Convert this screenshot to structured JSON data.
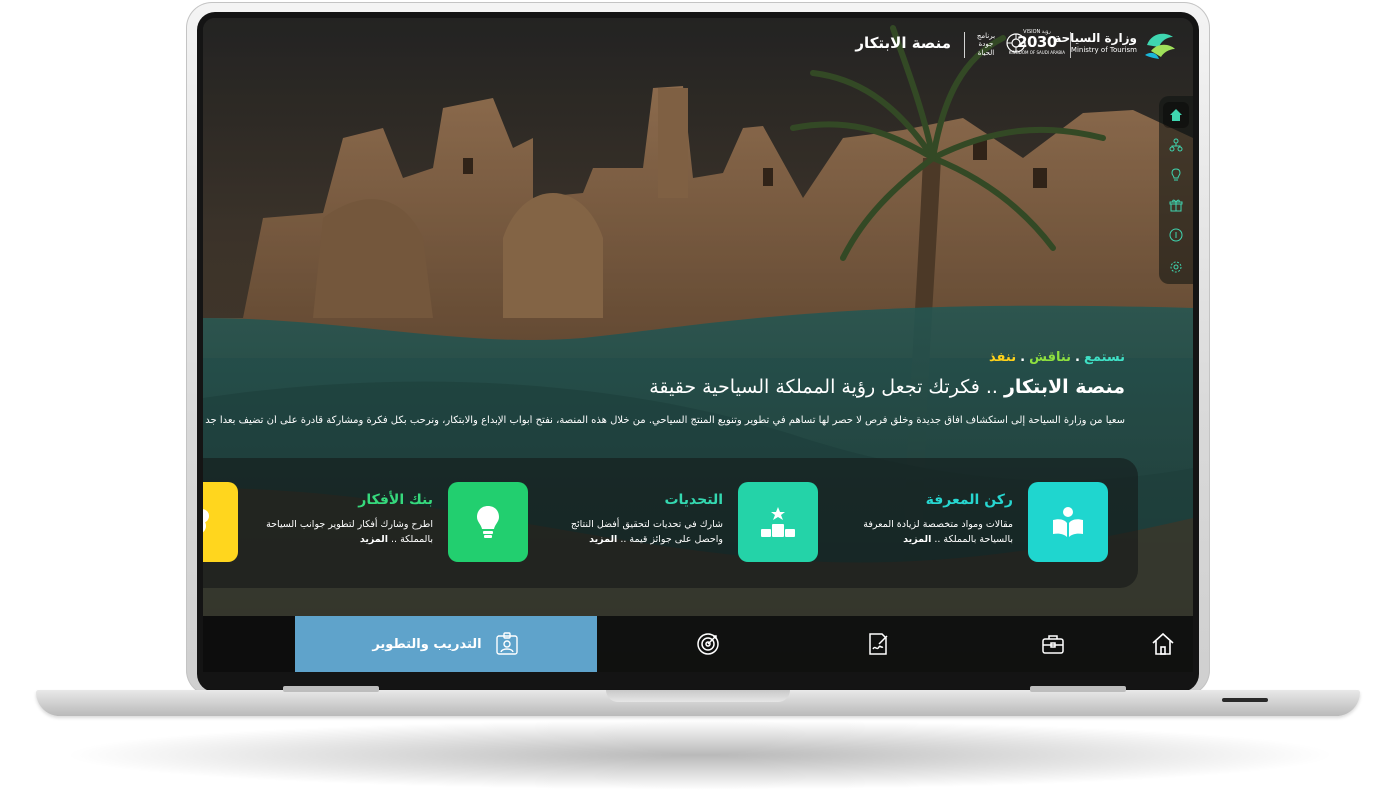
{
  "header": {
    "platform_title": "منصة الابتكار",
    "ministry_ar": "وزارة السياحة",
    "ministry_en": "Ministry of Tourism",
    "vision_small": "VISION رؤية",
    "vision_year": "2030",
    "vision_sub": "KINGDOM OF SAUDI ARABIA",
    "quality_ar": "برنامج جودة الحياة"
  },
  "side_rail": {
    "items": [
      {
        "icon": "home-icon",
        "active": true
      },
      {
        "icon": "org-chart-icon",
        "active": false
      },
      {
        "icon": "lightbulb-icon",
        "active": false
      },
      {
        "icon": "gift-icon",
        "active": false
      },
      {
        "icon": "info-icon",
        "active": false
      },
      {
        "icon": "gear-icon",
        "active": false
      }
    ]
  },
  "hero": {
    "tagline": {
      "t1": "نستمع",
      "t2": "نناقش",
      "t3": "ننفذ",
      "sep": "."
    },
    "title_strong": "منصة الابتكار",
    "title_rest": " .. فكرتك تجعل رؤية المملكة السياحية حقيقة",
    "description": "سعياً من وزارة السياحة إلى استكشاف آفاق جديدة وخلق فرص لا حصر لها تساهم في تطوير وتنويع المنتج السياحي. من خلال هذه المنصة، نفتح أبواب الإبداع والابتكار، ونرحب بكل فكرة ومشاركة قادرة على أن تضيف بعداً جد"
  },
  "features": [
    {
      "title": "ركن المعرفة",
      "desc": "مقالات ومواد متخصصة لزيادة المعرفة بالسياحة بالمملكة ..",
      "more": "المزيد",
      "icon": "book-reader-icon",
      "color": "#1fd6cf",
      "title_color": "#27d6d0"
    },
    {
      "title": "التحديات",
      "desc": "شارك في تحديات لتحقيق أفضل النتائج واحصل على جوائز قيمة ..",
      "more": "المزيد",
      "icon": "podium-star-icon",
      "color": "#24d3a8",
      "title_color": "#34d8b0"
    },
    {
      "title": "بنك الأفكار",
      "desc": "اطرح وشارك أفكار لتطوير جوانب السياحة بالمملكة ..",
      "more": "المزيد",
      "icon": "lightbulb-icon",
      "color": "#22cf6f",
      "title_color": "#36d97c"
    },
    {
      "title": "",
      "desc": "",
      "more": "",
      "icon": "brain-icon",
      "color": "#ffd61e",
      "title_color": "#ffd61e"
    }
  ],
  "bottom_nav": {
    "items": [
      {
        "icon": "home-outline-icon",
        "label": ""
      },
      {
        "icon": "briefcase-icon",
        "label": ""
      },
      {
        "icon": "document-signature-icon",
        "label": ""
      },
      {
        "icon": "target-arrow-icon",
        "label": ""
      },
      {
        "icon": "id-badge-icon",
        "label": "التدريب والتطوير",
        "active": true
      }
    ]
  },
  "colors": {
    "teal": "#1fd6cf",
    "green": "#22cf6f",
    "yellow": "#ffd21a",
    "active_nav": "#5fa3cb"
  }
}
